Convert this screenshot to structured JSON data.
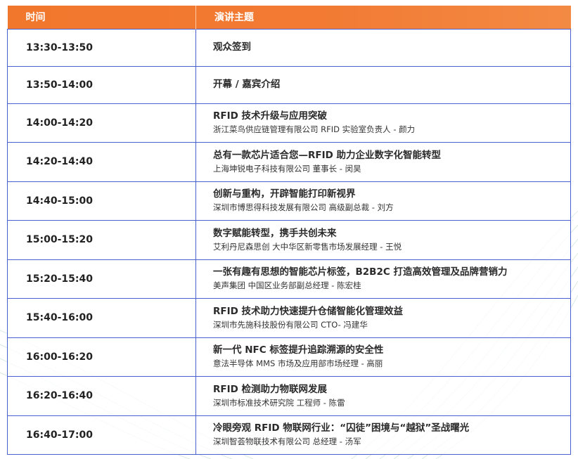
{
  "header": {
    "time_label": "时间",
    "topic_label": "演讲主题"
  },
  "rows": [
    {
      "time": "13:30-13:50",
      "title": "观众签到",
      "speaker": ""
    },
    {
      "time": "13:50-14:00",
      "title": "开幕 / 嘉宾介绍",
      "speaker": ""
    },
    {
      "time": "14:00-14:20",
      "title": "RFID 技术升级与应用突破",
      "speaker": "浙江菜鸟供应链管理有限公司 RFID 实验室负责人 - 颜力"
    },
    {
      "time": "14:20-14:40",
      "title": "总有一款芯片适合您—RFID 助力企业数字化智能转型",
      "speaker": "上海坤锐电子科技有限公司 董事长 - 闵昊"
    },
    {
      "time": "14:40-15:00",
      "title": "创新与重构，开辟智能打印新视界",
      "speaker": "深圳市博思得科技发展有限公司 高级副总裁 - 刘方"
    },
    {
      "time": "15:00-15:20",
      "title": "数字赋能转型，携手共创未来",
      "speaker": "艾利丹尼森思创 大中华区新零售市场发展经理 - 王悦"
    },
    {
      "time": "15:20-15:40",
      "title": "一张有趣有思想的智能芯片标签，B2B2C 打造高效管理及品牌营销力",
      "speaker": "美声集团 中国区业务部副总经理 - 陈宏桂"
    },
    {
      "time": "15:40-16:00",
      "title": "RFID 技术助力快速提升仓储智能化管理效益",
      "speaker": "深圳市先施科技股份有限公司 CTO- 冯建华"
    },
    {
      "time": "16:00-16:20",
      "title": "新一代 NFC 标签提升追踪溯源的安全性",
      "speaker": "意法半导体 MMS 市场及应用部市场经理 - 高丽"
    },
    {
      "time": "16:20-16:40",
      "title": "RFID 检测助力物联网发展",
      "speaker": "深圳市标准技术研究院 工程师 - 陈雷"
    },
    {
      "time": "16:40-17:00",
      "title": "冷眼旁观 RFID 物联网行业：“囚徒”困境与“越狱”圣战曙光",
      "speaker": "深圳智荟物联技术有限公司 总经理 - 汤军"
    }
  ],
  "colors": {
    "header_start": "#f1772c",
    "header_end": "#f38a44",
    "border": "#4a5fd0",
    "bg_lines": "#cfe6d8"
  }
}
